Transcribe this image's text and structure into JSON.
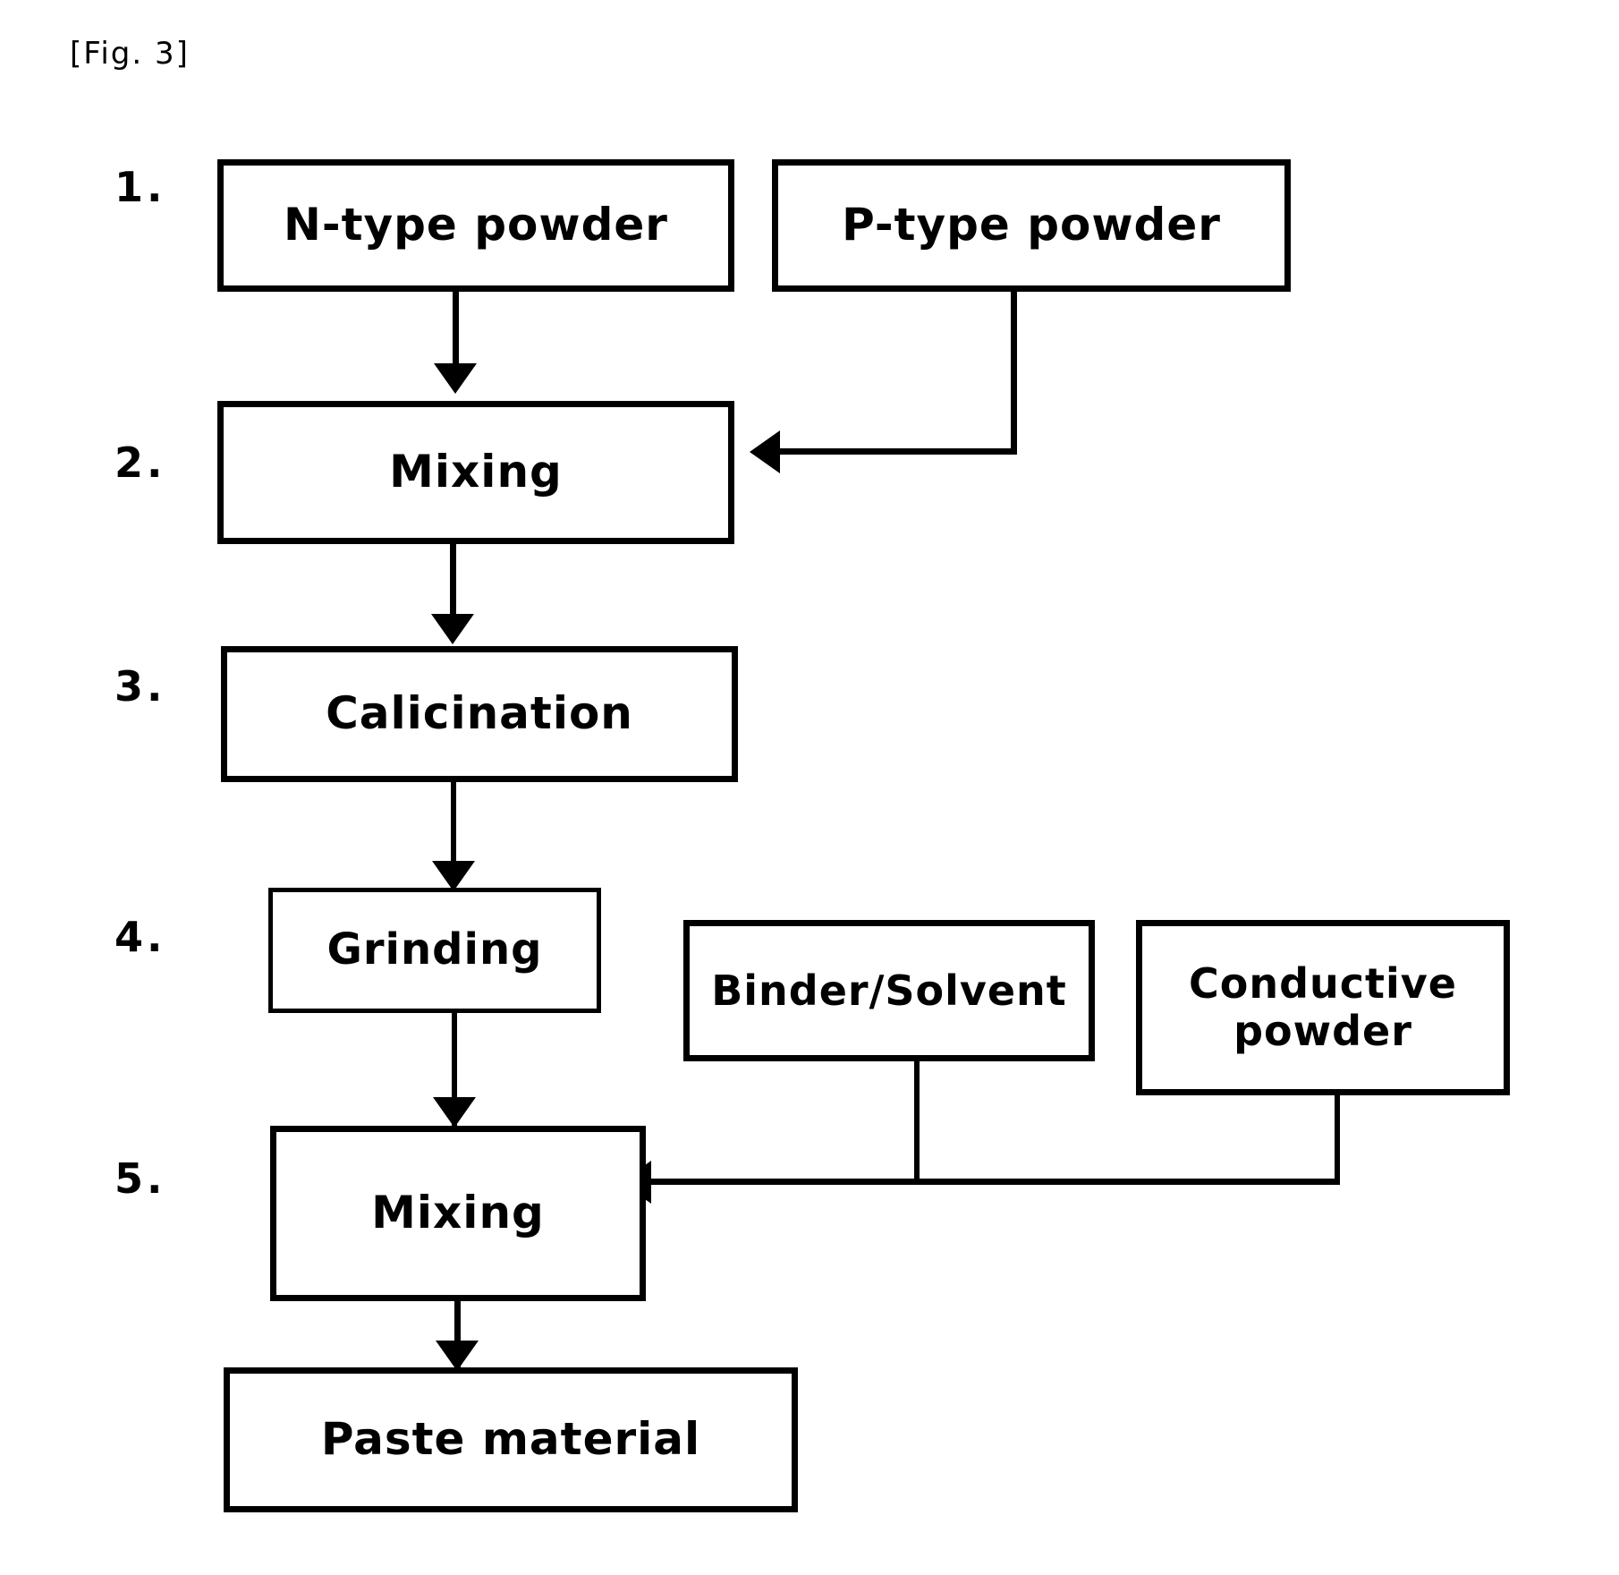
{
  "figure": {
    "label": "[Fig. 3]",
    "type": "process-flow-diagram",
    "title_visible": false
  },
  "steps": [
    {
      "number": "1."
    },
    {
      "number": "2."
    },
    {
      "number": "3."
    },
    {
      "number": "4."
    },
    {
      "number": "5."
    }
  ],
  "nodes": {
    "n_type_powder": "N-type powder",
    "p_type_powder": "P-type powder",
    "mixing_1": "Mixing",
    "calicination": "Calicination",
    "grinding": "Grinding",
    "binder_solvent": "Binder/Solvent",
    "conductive_powder": "Conductive\npowder",
    "mixing_2": "Mixing",
    "paste_material": "Paste material"
  },
  "colors": {
    "ink": "#000000",
    "paper": "#ffffff"
  }
}
